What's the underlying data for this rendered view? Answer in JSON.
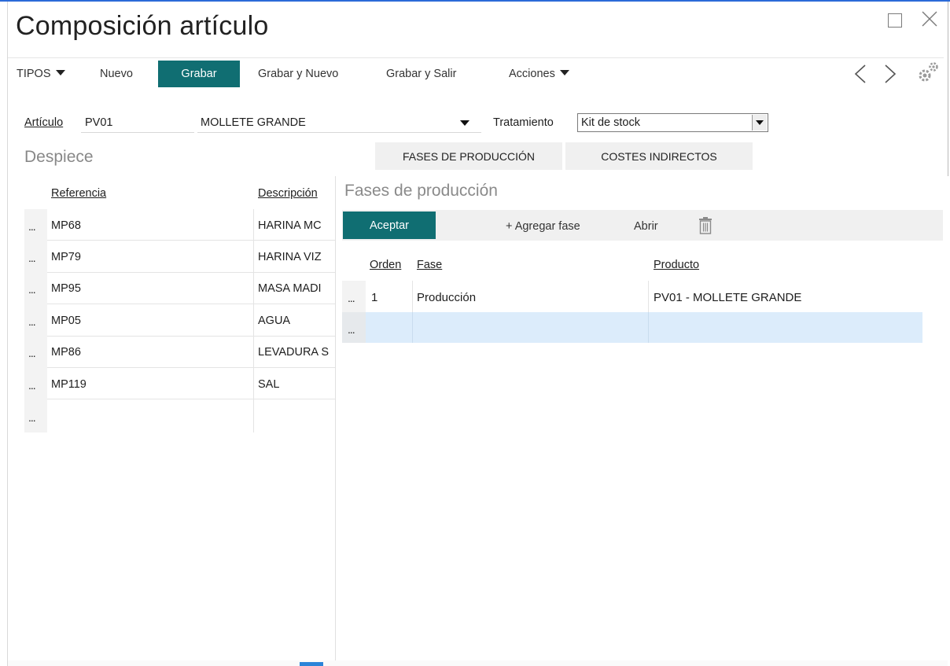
{
  "window": {
    "title": "Composición artículo"
  },
  "toolbar": {
    "tipos_label": "TIPOS",
    "nuevo_label": "Nuevo",
    "grabar_label": "Grabar",
    "grabar_nuevo_label": "Grabar y Nuevo",
    "grabar_salir_label": "Grabar y Salir",
    "acciones_label": "Acciones",
    "prev_glyph": "〈",
    "next_glyph": "〉"
  },
  "form": {
    "articulo_label": "Artículo",
    "articulo_code": "PV01",
    "articulo_desc": "MOLLETE GRANDE",
    "tratamiento_label": "Tratamiento",
    "tratamiento_value": "Kit de stock"
  },
  "despiece": {
    "title": "Despiece",
    "col_referencia": "Referencia",
    "col_descripcion": "Descripción",
    "rows": [
      {
        "dots": "...",
        "ref": "MP68",
        "desc": "HARINA MC"
      },
      {
        "dots": "...",
        "ref": "MP79",
        "desc": "HARINA VIZ"
      },
      {
        "dots": "...",
        "ref": "MP95",
        "desc": "MASA MADI"
      },
      {
        "dots": "...",
        "ref": "MP05",
        "desc": "AGUA"
      },
      {
        "dots": "...",
        "ref": "MP86",
        "desc": "LEVADURA S"
      },
      {
        "dots": "...",
        "ref": "MP119",
        "desc": "SAL"
      },
      {
        "dots": "...",
        "ref": "",
        "desc": ""
      }
    ]
  },
  "tabs": {
    "fases_label": "FASES DE PRODUCCIÓN",
    "costes_label": "COSTES INDIRECTOS"
  },
  "fases": {
    "title": "Fases de producción",
    "aceptar_label": "Aceptar",
    "agregar_label": "+ Agregar fase",
    "abrir_label": "Abrir",
    "col_orden": "Orden",
    "col_fase": "Fase",
    "col_producto": "Producto",
    "rows": [
      {
        "dots": "...",
        "orden": "1",
        "fase": "Producción",
        "producto": "PV01 - MOLLETE GRANDE"
      },
      {
        "dots": "...",
        "orden": "",
        "fase": "",
        "producto": ""
      }
    ]
  },
  "colors": {
    "accent": "#106e72",
    "selection": "#dcecfb"
  },
  "icons": [
    "maximize-icon",
    "close-icon",
    "caret-down-icon",
    "chevron-left-icon",
    "chevron-right-icon",
    "gear-icon",
    "trash-icon"
  ]
}
